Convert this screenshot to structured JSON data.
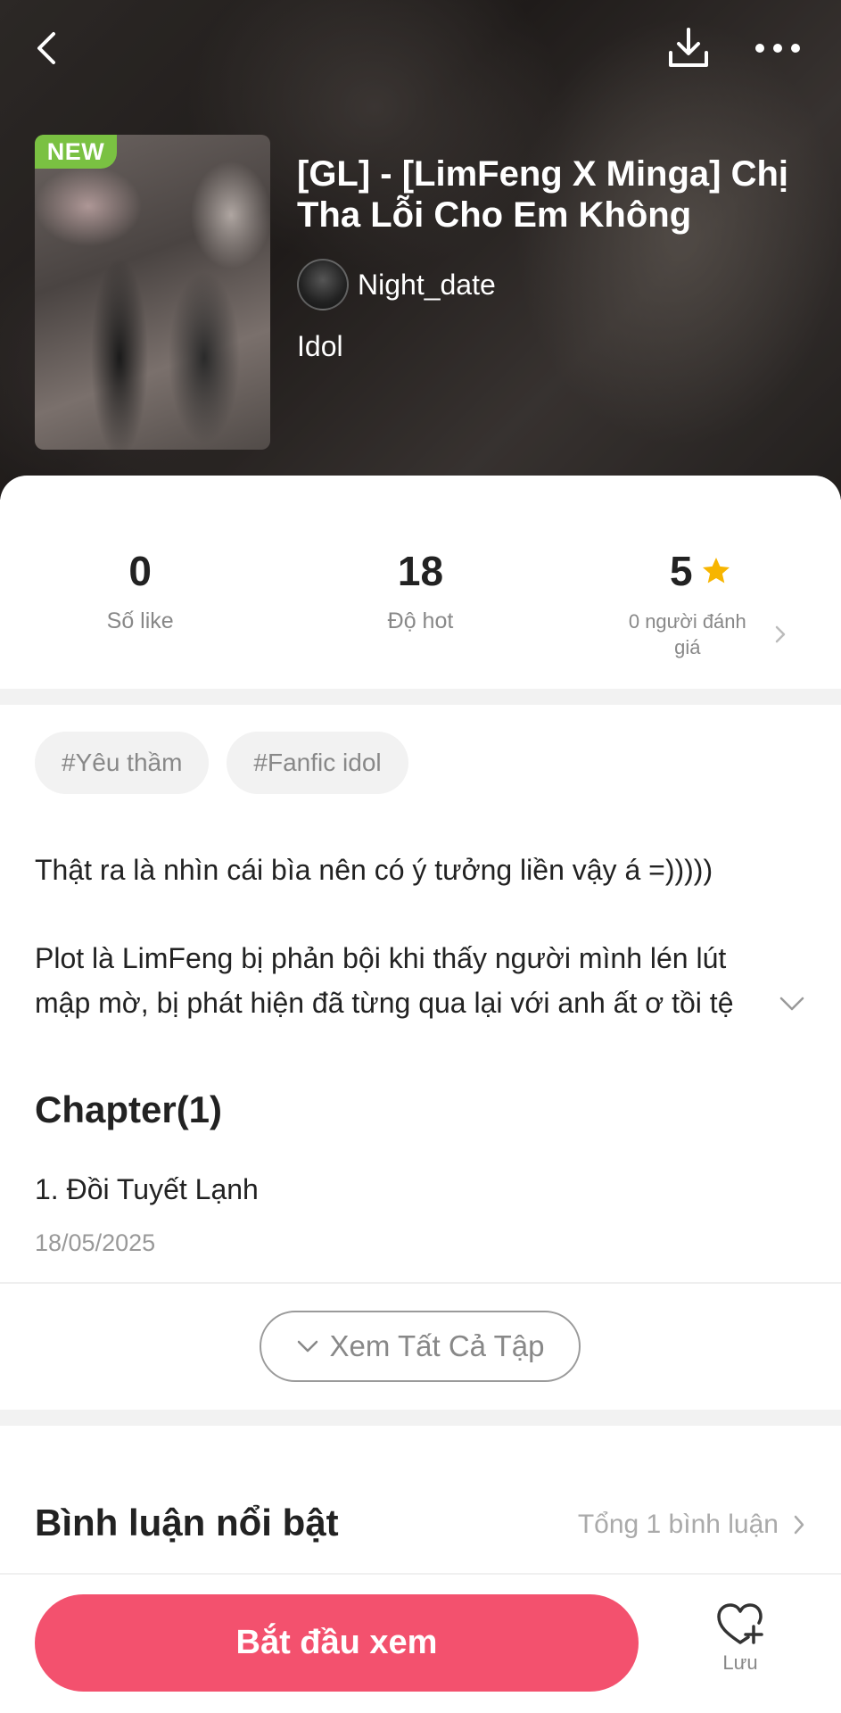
{
  "header": {
    "badge": "NEW",
    "title": "[GL] - [LimFeng X Minga] Chị Tha Lỗi Cho Em Không",
    "author": "Night_date",
    "genre": "Idol",
    "icons": [
      "back-arrow-icon",
      "download-icon",
      "more-icon"
    ]
  },
  "stats": {
    "likes": {
      "value": "0",
      "label": "Số like"
    },
    "hot": {
      "value": "18",
      "label": "Độ hot"
    },
    "rating": {
      "value": "5",
      "label": "0 người đánh giá",
      "star_color": "#f7b500"
    }
  },
  "tags": [
    "#Yêu thầm",
    "#Fanfic idol"
  ],
  "description": {
    "paragraph1": "Thật ra là nhìn cái bìa nên có ý tưởng liền vậy á =)))))",
    "paragraph2_line1": "Plot là LimFeng bị phản bội khi thấy người mình lén lút",
    "paragraph2_line2": "mập mờ, bị phát hiện đã từng qua lại với anh ất ơ tồi tệ"
  },
  "chapters": {
    "heading": "Chapter(1)",
    "items": [
      {
        "title": "1. Đồi Tuyết Lạnh",
        "date": "18/05/2025"
      }
    ],
    "view_all_label": "Xem Tất Cả Tập"
  },
  "comments": {
    "heading": "Bình luận nổi bật",
    "total": "Tổng 1 bình luận"
  },
  "footer": {
    "start_label": "Bắt đầu xem",
    "save_label": "Lưu",
    "accent_color": "#f3516e"
  }
}
